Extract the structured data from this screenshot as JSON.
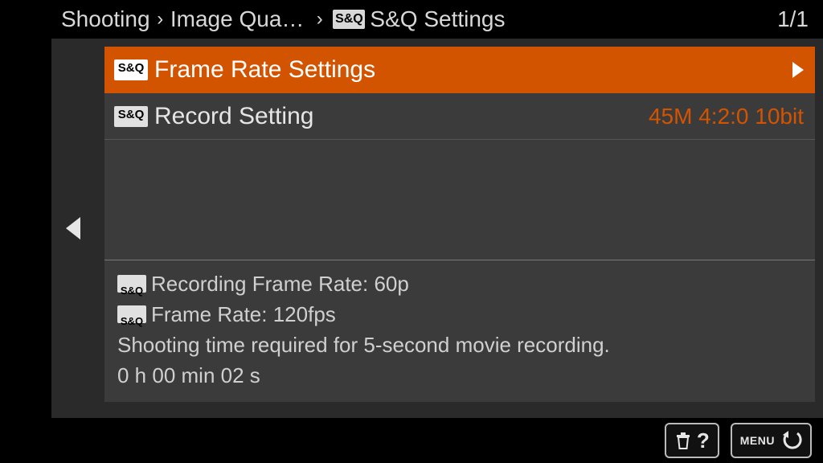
{
  "breadcrumb": {
    "part1": "Shooting",
    "part2": "Image Qua…",
    "icon": "S&Q",
    "part3": "S&Q Settings"
  },
  "page_counter": "1/1",
  "menu": {
    "items": [
      {
        "icon": "S&Q",
        "label": "Frame Rate Settings"
      },
      {
        "icon": "S&Q",
        "label": "Record Setting",
        "value": "45M 4:2:0 10bit"
      }
    ]
  },
  "info": {
    "line1_icon": "S&Q",
    "line1": "Recording Frame Rate: 60p",
    "line2_icon": "S&Q",
    "line2": "Frame Rate: 120fps",
    "line3": "Shooting time required for 5-second movie recording.",
    "line4": "0 h 00 min 02 s"
  },
  "footer": {
    "help": "?",
    "menu": "MENU"
  }
}
